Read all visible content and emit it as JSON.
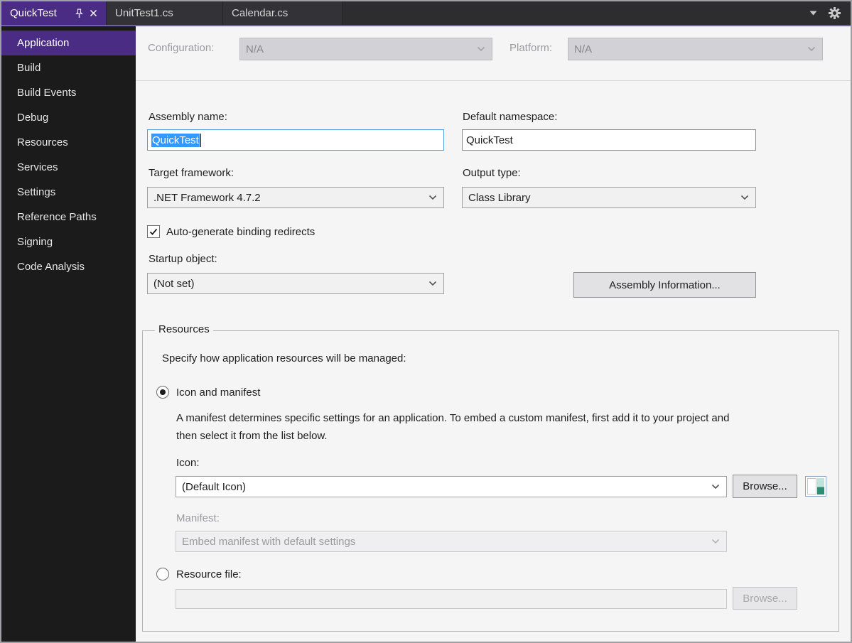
{
  "window": {
    "tabs": [
      {
        "label": "QuickTest",
        "active": true
      },
      {
        "label": "UnitTest1.cs",
        "active": false
      },
      {
        "label": "Calendar.cs",
        "active": false
      }
    ]
  },
  "sidebar": {
    "items": [
      {
        "label": "Application",
        "selected": true
      },
      {
        "label": "Build",
        "selected": false
      },
      {
        "label": "Build Events",
        "selected": false
      },
      {
        "label": "Debug",
        "selected": false
      },
      {
        "label": "Resources",
        "selected": false
      },
      {
        "label": "Services",
        "selected": false
      },
      {
        "label": "Settings",
        "selected": false
      },
      {
        "label": "Reference Paths",
        "selected": false
      },
      {
        "label": "Signing",
        "selected": false
      },
      {
        "label": "Code Analysis",
        "selected": false
      }
    ]
  },
  "config_bar": {
    "configuration_label": "Configuration:",
    "configuration_value": "N/A",
    "platform_label": "Platform:",
    "platform_value": "N/A"
  },
  "form": {
    "assembly_name_label": "Assembly name:",
    "assembly_name_value": "QuickTest",
    "assembly_name_selected": true,
    "default_namespace_label": "Default namespace:",
    "default_namespace_value": "QuickTest",
    "target_framework_label": "Target framework:",
    "target_framework_value": ".NET Framework 4.7.2",
    "output_type_label": "Output type:",
    "output_type_value": "Class Library",
    "autogen_label": "Auto-generate binding redirects",
    "autogen_checked": true,
    "startup_object_label": "Startup object:",
    "startup_object_value": "(Not set)",
    "assembly_info_button": "Assembly Information..."
  },
  "resources_group": {
    "group_title": "Resources",
    "description": "Specify how application resources will be managed:",
    "icon_manifest_radio": "Icon and manifest",
    "icon_manifest_selected": true,
    "manifest_help": "A manifest determines specific settings for an application. To embed a custom manifest, first add it to your project and then select it from the list below.",
    "icon_label": "Icon:",
    "icon_value": "(Default Icon)",
    "browse_button": "Browse...",
    "manifest_label": "Manifest:",
    "manifest_value": "Embed manifest with default settings",
    "manifest_enabled": false,
    "resource_file_radio": "Resource file:",
    "resource_file_selected": false,
    "resource_file_value": "",
    "browse_disabled_button": "Browse..."
  },
  "icons": {
    "tab_pin": "pin-icon",
    "tab_close": "close-icon",
    "tabbar_dropdown": "chevron-down-icon",
    "tabbar_options": "gear-icon",
    "combo_arrow": "chevron-down-icon",
    "checkbox_mark": "check-icon",
    "icon_preview": "application-icon-preview"
  },
  "colors": {
    "accent_purple": "#4B2C85",
    "accent_underline": "#6E63A9",
    "tab_bar_background": "#2D2D30",
    "sidebar_background": "#1B1B1C",
    "content_background": "#F5F5F5",
    "selection_blue": "#3399FF"
  }
}
